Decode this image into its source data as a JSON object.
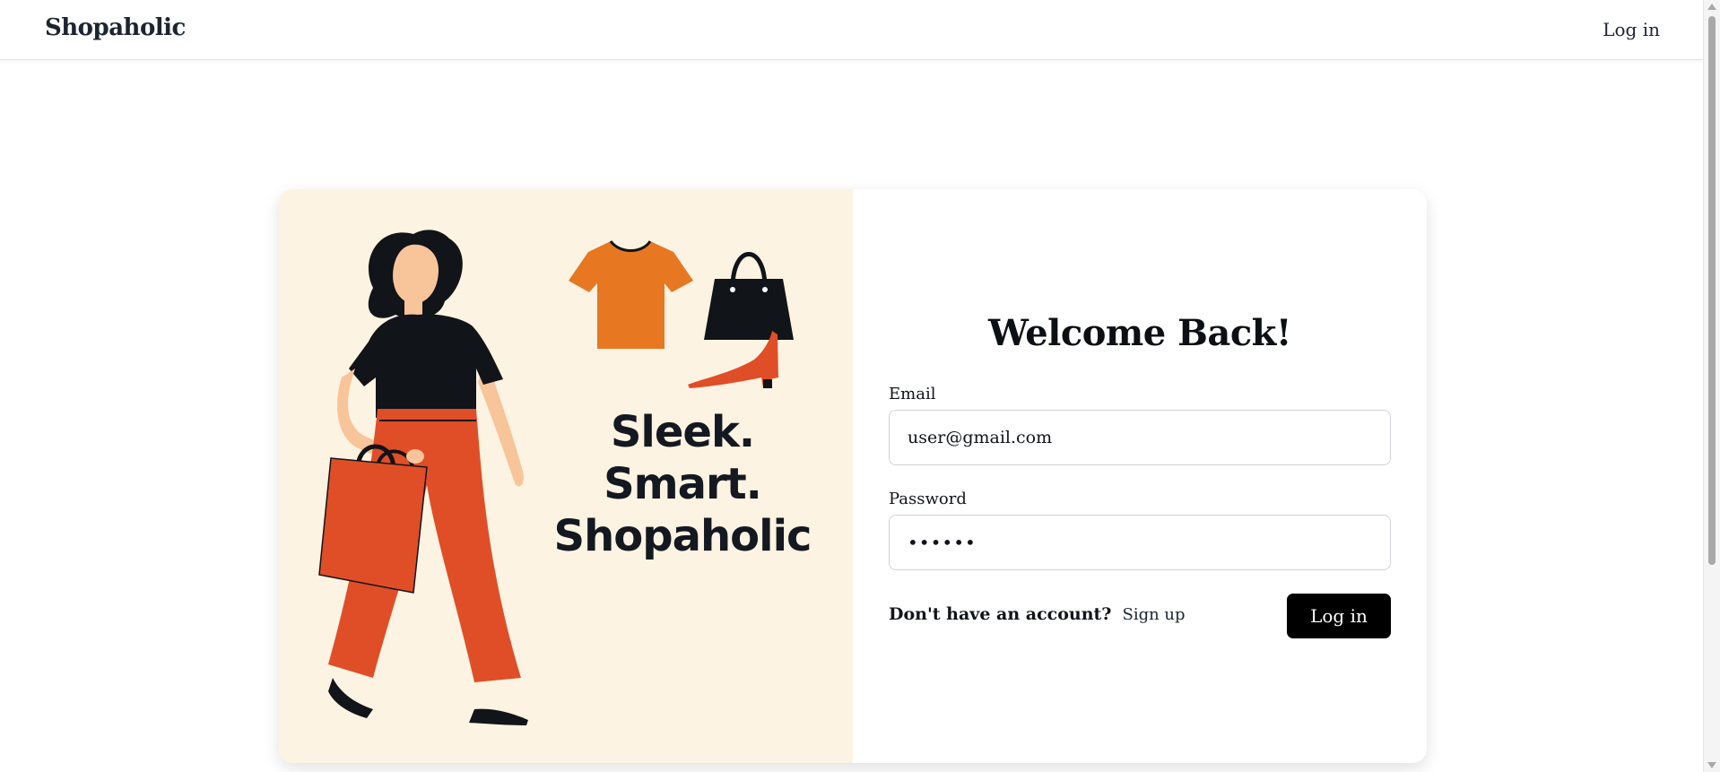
{
  "navbar": {
    "brand": "Shopaholic",
    "login_label": "Log in"
  },
  "hero": {
    "tagline_line1": "Sleek. Smart.",
    "tagline_line2": "Shopaholic",
    "illustration_icons": [
      "woman-shopper",
      "orange-tshirt",
      "black-handbag",
      "red-high-heel-shoe"
    ]
  },
  "login_form": {
    "title": "Welcome Back!",
    "email_label": "Email",
    "email_value": "user@gmail.com",
    "password_label": "Password",
    "password_value": "••••••",
    "signup_question": "Don't have an account?",
    "signup_link": "Sign up",
    "submit_label": "Log in"
  },
  "colors": {
    "hero_background": "#fdf3e2",
    "accent_orange": "#e87722",
    "accent_red": "#e04e27",
    "button_background": "#000000"
  }
}
